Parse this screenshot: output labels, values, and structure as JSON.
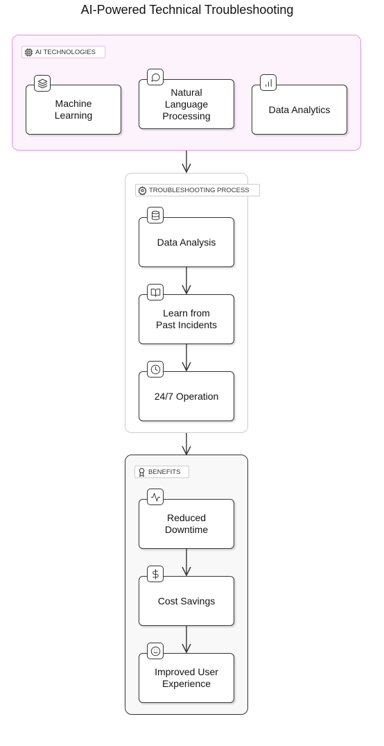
{
  "title": "AI-Powered Technical Troubleshooting",
  "groups": {
    "ai": {
      "label": "AI TECHNOLOGIES",
      "icon": "cpu-icon",
      "fill": "#fcf3fc",
      "border": "#e98fe3",
      "nodes": [
        {
          "label": "Machine\nLearning",
          "icon": "layers-icon"
        },
        {
          "label": "Natural\nLanguage\nProcessing",
          "icon": "message-circle-icon"
        },
        {
          "label": "Data Analytics",
          "icon": "bar-chart-icon"
        }
      ]
    },
    "process": {
      "label": "TROUBLESHOOTING PROCESS",
      "icon": "gear-icon",
      "fill": "#ffffff",
      "border": "#cccccc",
      "nodes": [
        {
          "label": "Data Analysis",
          "icon": "database-icon"
        },
        {
          "label": "Learn from\nPast Incidents",
          "icon": "book-open-icon"
        },
        {
          "label": "24/7 Operation",
          "icon": "clock-icon"
        }
      ]
    },
    "benefits": {
      "label": "BENEFITS",
      "icon": "award-icon",
      "fill": "#f8f8f8",
      "border": "#333333",
      "nodes": [
        {
          "label": "Reduced\nDowntime",
          "icon": "activity-icon"
        },
        {
          "label": "Cost Savings",
          "icon": "dollar-icon"
        },
        {
          "label": "Improved User\nExperience",
          "icon": "smile-icon"
        }
      ]
    }
  }
}
